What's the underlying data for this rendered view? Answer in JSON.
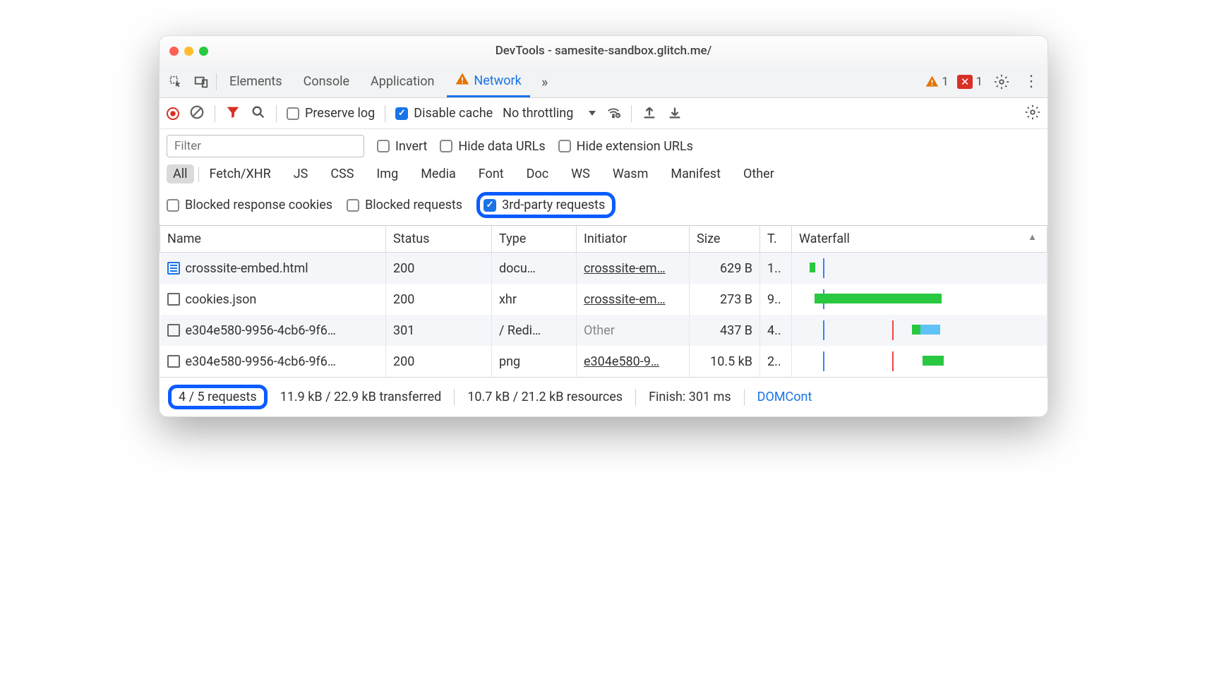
{
  "window": {
    "title": "DevTools - samesite-sandbox.glitch.me/"
  },
  "tabs": {
    "items": [
      "Elements",
      "Console",
      "Application",
      "Network"
    ],
    "active": "Network"
  },
  "badges": {
    "warn_count": "1",
    "err_count": "1"
  },
  "toolbar": {
    "preserve_log": "Preserve log",
    "disable_cache": "Disable cache",
    "throttling": "No throttling"
  },
  "filter": {
    "placeholder": "Filter",
    "invert": "Invert",
    "hide_data_urls": "Hide data URLs",
    "hide_ext_urls": "Hide extension URLs"
  },
  "types": [
    "All",
    "Fetch/XHR",
    "JS",
    "CSS",
    "Img",
    "Media",
    "Font",
    "Doc",
    "WS",
    "Wasm",
    "Manifest",
    "Other"
  ],
  "type_active": "All",
  "extra_filters": {
    "blocked_cookies": "Blocked response cookies",
    "blocked_requests": "Blocked requests",
    "third_party": "3rd-party requests"
  },
  "columns": {
    "name": "Name",
    "status": "Status",
    "type": "Type",
    "initiator": "Initiator",
    "size": "Size",
    "time": "T.",
    "waterfall": "Waterfall"
  },
  "rows": [
    {
      "icon": "doc",
      "name": "crosssite-embed.html",
      "status": "200",
      "type": "docu…",
      "initiator": "crosssite-em…",
      "initiator_muted": false,
      "size": "629 B",
      "time": "1.."
    },
    {
      "icon": "blank",
      "name": "cookies.json",
      "status": "200",
      "type": "xhr",
      "initiator": "crosssite-em…",
      "initiator_muted": false,
      "size": "273 B",
      "time": "9.."
    },
    {
      "icon": "blank",
      "name": "e304e580-9956-4cb6-9f6…",
      "status": "301",
      "type": "/ Redi…",
      "initiator": "Other",
      "initiator_muted": true,
      "size": "437 B",
      "time": "4.."
    },
    {
      "icon": "blank",
      "name": "e304e580-9956-4cb6-9f6…",
      "status": "200",
      "type": "png",
      "initiator": "e304e580-9…",
      "initiator_muted": false,
      "size": "10.5 kB",
      "time": "2.."
    }
  ],
  "status": {
    "requests": "4 / 5 requests",
    "transferred": "11.9 kB / 22.9 kB transferred",
    "resources": "10.7 kB / 21.2 kB resources",
    "finish": "Finish: 301 ms",
    "domcontent": "DOMCont"
  }
}
